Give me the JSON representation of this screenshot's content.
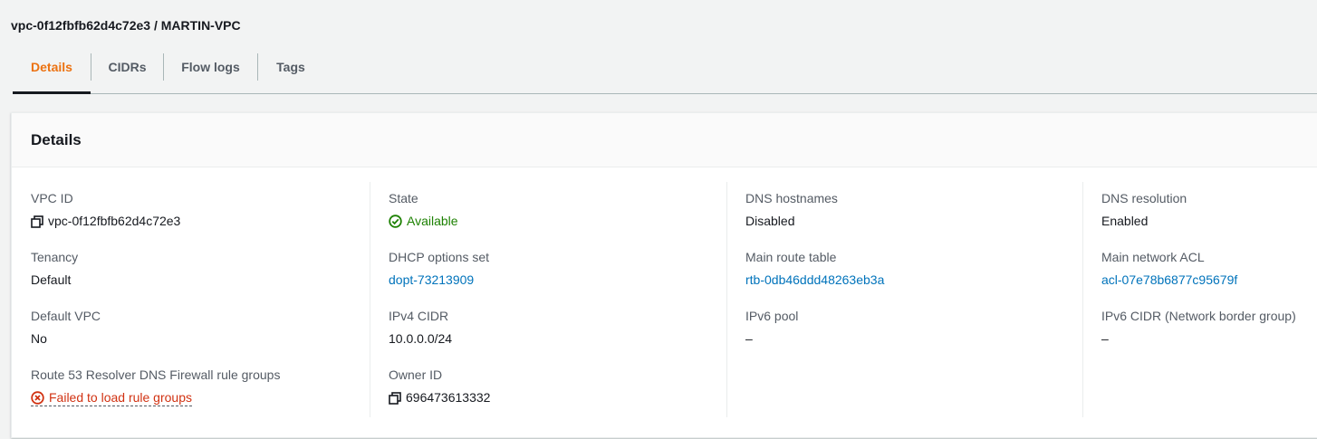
{
  "page": {
    "title": "vpc-0f12fbfb62d4c72e3 / MARTIN-VPC"
  },
  "tabs": [
    {
      "label": "Details"
    },
    {
      "label": "CIDRs"
    },
    {
      "label": "Flow logs"
    },
    {
      "label": "Tags"
    }
  ],
  "panel": {
    "title": "Details",
    "fields": {
      "vpc_id": {
        "label": "VPC ID",
        "value": "vpc-0f12fbfb62d4c72e3",
        "icon": "copy-icon"
      },
      "tenancy": {
        "label": "Tenancy",
        "value": "Default"
      },
      "default_vpc": {
        "label": "Default VPC",
        "value": "No"
      },
      "route53": {
        "label": "Route 53 Resolver DNS Firewall rule groups",
        "value": "Failed to load rule groups",
        "icon": "error-circle-icon"
      },
      "state": {
        "label": "State",
        "value": "Available",
        "icon": "check-circle-icon"
      },
      "dhcp": {
        "label": "DHCP options set",
        "value": "dopt-73213909"
      },
      "ipv4_cidr": {
        "label": "IPv4 CIDR",
        "value": "10.0.0.0/24"
      },
      "owner_id": {
        "label": "Owner ID",
        "value": "696473613332",
        "icon": "copy-icon"
      },
      "dns_hostnames": {
        "label": "DNS hostnames",
        "value": "Disabled"
      },
      "main_route_table": {
        "label": "Main route table",
        "value": "rtb-0db46ddd48263eb3a"
      },
      "ipv6_pool": {
        "label": "IPv6 pool",
        "value": "–"
      },
      "dns_resolution": {
        "label": "DNS resolution",
        "value": "Enabled"
      },
      "main_network_acl": {
        "label": "Main network ACL",
        "value": "acl-07e78b6877c95679f"
      },
      "ipv6_cidr": {
        "label": "IPv6 CIDR (Network border group)",
        "value": "–"
      }
    }
  },
  "colors": {
    "accent": "#ec7211",
    "link": "#0073bb",
    "success": "#1d8102",
    "error": "#d13212"
  }
}
